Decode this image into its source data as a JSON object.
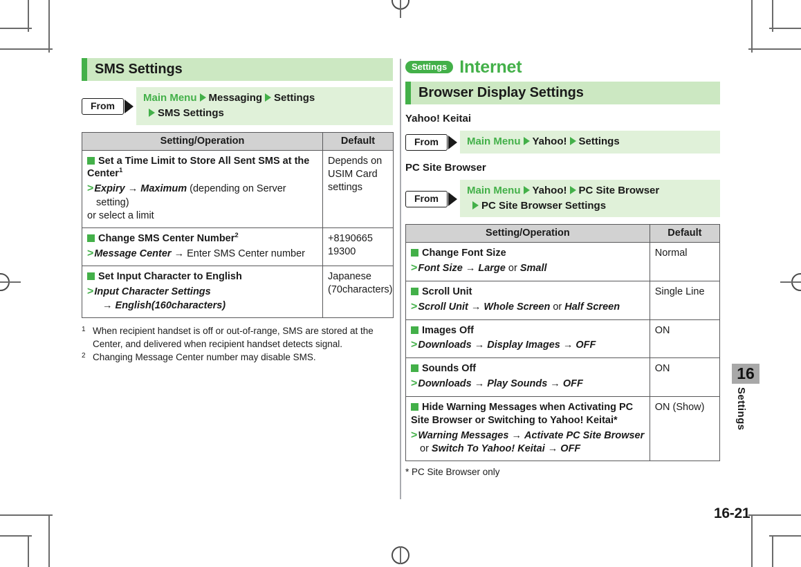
{
  "marks": {
    "label": "print-registration-marks"
  },
  "left_column": {
    "section_heading": "SMS Settings",
    "from_nav": {
      "badge": "From",
      "line1_menu": "Main Menu",
      "line1_rest": [
        "Messaging",
        "Settings"
      ],
      "line2": [
        "SMS Settings"
      ]
    },
    "table": {
      "headers": [
        "Setting/Operation",
        "Default"
      ],
      "rows": [
        {
          "title": "Set a Time Limit to Store All Sent SMS at the Center",
          "title_sup": "1",
          "steps": [
            {
              "bold_italic": "Expiry",
              "arrow": " → ",
              "bold_italic2": "Maximum",
              "plain": " (depending on Server setting)",
              "cont": "or select a limit"
            }
          ],
          "default": "Depends on USIM Card settings"
        },
        {
          "title": "Change SMS Center Number",
          "title_sup": "2",
          "steps": [
            {
              "bold_italic": "Message Center",
              "arrow": " → ",
              "plain": "Enter SMS Center number"
            }
          ],
          "default": "+8190665 19300"
        },
        {
          "title": "Set Input Character to English",
          "title_sup": "",
          "steps": [
            {
              "bold_italic": "Input Character Settings",
              "cont_arrow": "→ ",
              "cont_bold_italic": "English(160characters)"
            }
          ],
          "default": "Japanese (70characters)"
        }
      ]
    },
    "footnotes": [
      {
        "marker": "1",
        "text": "When recipient handset is off or out-of-range, SMS are stored at the Center, and delivered when recipient handset detects signal."
      },
      {
        "marker": "2",
        "text": "Changing Message Center number may disable SMS."
      }
    ]
  },
  "right_column": {
    "chapter_pill": "Settings",
    "chapter_title": "Internet",
    "section_heading": "Browser Display Settings",
    "sub_label_1": "Yahoo! Keitai",
    "from_nav_1": {
      "badge": "From",
      "line1_menu": "Main Menu",
      "line1_rest": [
        "Yahoo!",
        "Settings"
      ]
    },
    "sub_label_2": "PC Site Browser",
    "from_nav_2": {
      "badge": "From",
      "line1_menu": "Main Menu",
      "line1_rest": [
        "Yahoo!",
        "PC Site Browser"
      ],
      "line2": [
        "PC Site Browser Settings"
      ]
    },
    "table": {
      "headers": [
        "Setting/Operation",
        "Default"
      ],
      "rows": [
        {
          "title": "Change Font Size",
          "step_parts": [
            {
              "t": "Font Size",
              "s": "bi"
            },
            {
              "t": " → ",
              "s": "arrow"
            },
            {
              "t": "Large",
              "s": "bi"
            },
            {
              "t": " or ",
              "s": "plain"
            },
            {
              "t": "Small",
              "s": "bi"
            }
          ],
          "default": "Normal"
        },
        {
          "title": "Scroll Unit",
          "step_parts": [
            {
              "t": "Scroll Unit",
              "s": "bi"
            },
            {
              "t": " → ",
              "s": "arrow"
            },
            {
              "t": "Whole Screen",
              "s": "bi"
            },
            {
              "t": " or ",
              "s": "plain"
            },
            {
              "t": "Half Screen",
              "s": "bi"
            }
          ],
          "default": "Single Line"
        },
        {
          "title": "Images Off",
          "step_parts": [
            {
              "t": "Downloads",
              "s": "bi"
            },
            {
              "t": " → ",
              "s": "arrow"
            },
            {
              "t": "Display Images",
              "s": "bi"
            },
            {
              "t": " → ",
              "s": "arrow"
            },
            {
              "t": "OFF",
              "s": "bi"
            }
          ],
          "default": "ON"
        },
        {
          "title": "Sounds Off",
          "step_parts": [
            {
              "t": "Downloads",
              "s": "bi"
            },
            {
              "t": " → ",
              "s": "arrow"
            },
            {
              "t": "Play Sounds",
              "s": "bi"
            },
            {
              "t": " → ",
              "s": "arrow"
            },
            {
              "t": "OFF",
              "s": "bi"
            }
          ],
          "default": "ON"
        },
        {
          "title": "Hide Warning Messages when Activating PC Site Browser or Switching to Yahoo! Keitai",
          "title_star": "*",
          "step_parts": [
            {
              "t": "Warning Messages",
              "s": "bi"
            },
            {
              "t": " → ",
              "s": "arrow"
            },
            {
              "t": "Activate PC Site Browser",
              "s": "bi"
            },
            {
              "t": " or ",
              "s": "plain"
            },
            {
              "t": "Switch To Yahoo! Keitai",
              "s": "bi"
            },
            {
              "t": " → ",
              "s": "arrow"
            },
            {
              "t": "OFF",
              "s": "bi"
            }
          ],
          "default": "ON (Show)"
        }
      ]
    },
    "star_note": "* PC Site Browser only"
  },
  "side_tab": {
    "number": "16",
    "word": "Settings"
  },
  "page_number": "16-21",
  "colors": {
    "accent_green": "#43b049",
    "pale_green": "#cce8c2",
    "path_green": "#e0f1d9",
    "table_header_gray": "#d2d2d2",
    "tab_gray": "#a8a8a8"
  }
}
